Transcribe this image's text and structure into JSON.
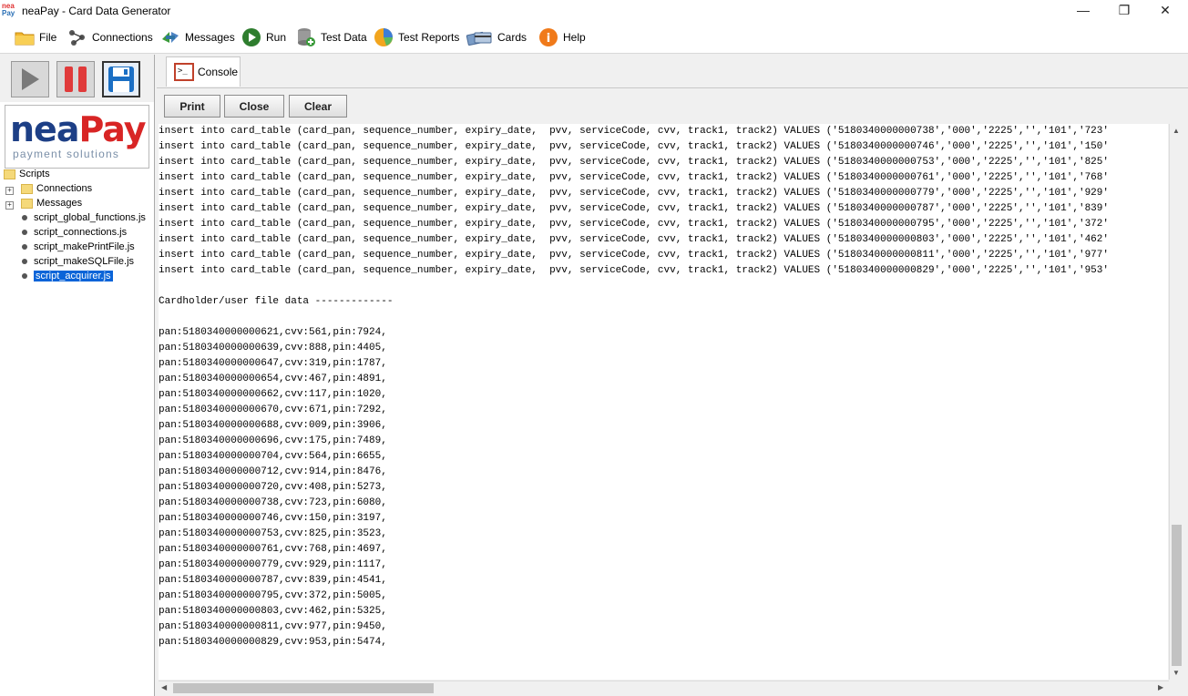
{
  "window": {
    "logo_top": "nea",
    "logo_bottom": "Pay",
    "title": "neaPay - Card Data Generator",
    "controls": {
      "minimize": "—",
      "restore": "❐",
      "close": "✕"
    }
  },
  "menu": [
    {
      "label": "File",
      "icon": "folder-icon"
    },
    {
      "label": "Connections",
      "icon": "network-icon"
    },
    {
      "label": "Messages",
      "icon": "messages-icon"
    },
    {
      "label": "Run",
      "icon": "run-icon"
    },
    {
      "label": "Test Data",
      "icon": "database-icon"
    },
    {
      "label": "Test Reports",
      "icon": "reports-icon"
    },
    {
      "label": "Cards",
      "icon": "cards-icon"
    },
    {
      "label": "Help",
      "icon": "help-icon"
    }
  ],
  "toolbar": {
    "buttons": [
      {
        "name": "play",
        "icon": "play-icon"
      },
      {
        "name": "pause",
        "icon": "pause-icon"
      },
      {
        "name": "save",
        "icon": "save-icon"
      }
    ]
  },
  "brand": {
    "name_part1": "nea",
    "name_part2": "Pay",
    "tagline": "payment solutions"
  },
  "tree": {
    "root": "Scripts",
    "folders": [
      "Connections",
      "Messages"
    ],
    "files": [
      "script_global_functions.js",
      "script_connections.js",
      "script_makePrintFile.js",
      "script_makeSQLFile.js",
      "script_acquirer.js"
    ],
    "selected_file": "script_acquirer.js"
  },
  "tabs": [
    {
      "label": "Console"
    }
  ],
  "buttons": {
    "print": "Print",
    "close": "Close",
    "clear": "Clear"
  },
  "console": {
    "text": "insert into card_table (card_pan, sequence_number, expiry_date,  pvv, serviceCode, cvv, track1, track2) VALUES ('5180340000000738','000','2225','','101','723'\ninsert into card_table (card_pan, sequence_number, expiry_date,  pvv, serviceCode, cvv, track1, track2) VALUES ('5180340000000746','000','2225','','101','150'\ninsert into card_table (card_pan, sequence_number, expiry_date,  pvv, serviceCode, cvv, track1, track2) VALUES ('5180340000000753','000','2225','','101','825'\ninsert into card_table (card_pan, sequence_number, expiry_date,  pvv, serviceCode, cvv, track1, track2) VALUES ('5180340000000761','000','2225','','101','768'\ninsert into card_table (card_pan, sequence_number, expiry_date,  pvv, serviceCode, cvv, track1, track2) VALUES ('5180340000000779','000','2225','','101','929'\ninsert into card_table (card_pan, sequence_number, expiry_date,  pvv, serviceCode, cvv, track1, track2) VALUES ('5180340000000787','000','2225','','101','839'\ninsert into card_table (card_pan, sequence_number, expiry_date,  pvv, serviceCode, cvv, track1, track2) VALUES ('5180340000000795','000','2225','','101','372'\ninsert into card_table (card_pan, sequence_number, expiry_date,  pvv, serviceCode, cvv, track1, track2) VALUES ('5180340000000803','000','2225','','101','462'\ninsert into card_table (card_pan, sequence_number, expiry_date,  pvv, serviceCode, cvv, track1, track2) VALUES ('5180340000000811','000','2225','','101','977'\ninsert into card_table (card_pan, sequence_number, expiry_date,  pvv, serviceCode, cvv, track1, track2) VALUES ('5180340000000829','000','2225','','101','953'\n\nCardholder/user file data -------------\n\npan:5180340000000621,cvv:561,pin:7924,\npan:5180340000000639,cvv:888,pin:4405,\npan:5180340000000647,cvv:319,pin:1787,\npan:5180340000000654,cvv:467,pin:4891,\npan:5180340000000662,cvv:117,pin:1020,\npan:5180340000000670,cvv:671,pin:7292,\npan:5180340000000688,cvv:009,pin:3906,\npan:5180340000000696,cvv:175,pin:7489,\npan:5180340000000704,cvv:564,pin:6655,\npan:5180340000000712,cvv:914,pin:8476,\npan:5180340000000720,cvv:408,pin:5273,\npan:5180340000000738,cvv:723,pin:6080,\npan:5180340000000746,cvv:150,pin:3197,\npan:5180340000000753,cvv:825,pin:3523,\npan:5180340000000761,cvv:768,pin:4697,\npan:5180340000000779,cvv:929,pin:1117,\npan:5180340000000787,cvv:839,pin:4541,\npan:5180340000000795,cvv:372,pin:5005,\npan:5180340000000803,cvv:462,pin:5325,\npan:5180340000000811,cvv:977,pin:9450,\npan:5180340000000829,cvv:953,pin:5474,"
  },
  "colors": {
    "selection": "#0a64d8",
    "brand_blue": "#1d3f86",
    "brand_red": "#d82525"
  }
}
